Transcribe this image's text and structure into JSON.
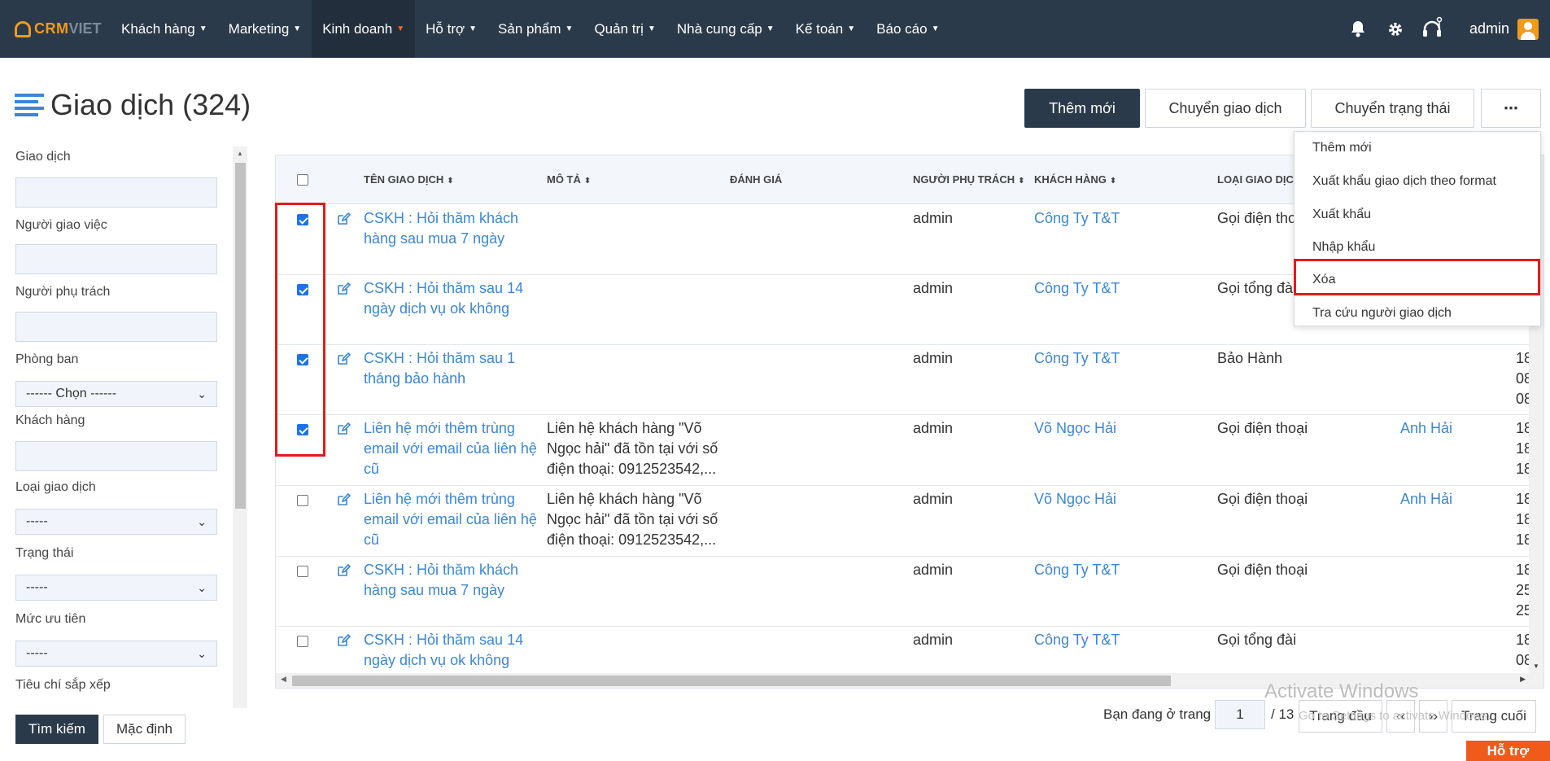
{
  "app": {
    "logo_primary": "CRM",
    "logo_secondary": "VIET",
    "user": "admin"
  },
  "nav": {
    "items": [
      {
        "label": "Khách hàng"
      },
      {
        "label": "Marketing"
      },
      {
        "label": "Kinh doanh"
      },
      {
        "label": "Hỗ trợ"
      },
      {
        "label": "Sản phẩm"
      },
      {
        "label": "Quản trị"
      },
      {
        "label": "Nhà cung cấp"
      },
      {
        "label": "Kế toán"
      },
      {
        "label": "Báo cáo"
      }
    ],
    "active_index": 2,
    "icons": [
      "bell-icon",
      "gear-icon",
      "headset-icon"
    ]
  },
  "page": {
    "title": "Giao dịch (324)",
    "buttons": {
      "add": "Thêm mới",
      "transfer": "Chuyển giao dịch",
      "change_status": "Chuyển trạng thái",
      "more": "⋯"
    }
  },
  "filters": {
    "transaction": "Giao dịch",
    "assigner": "Người giao việc",
    "owner": "Người phụ trách",
    "department": "Phòng ban",
    "department_value": "------ Chọn ------",
    "customer": "Khách hàng",
    "type": "Loại giao dịch",
    "type_value": "-----",
    "status": "Trạng thái",
    "status_value": "-----",
    "priority": "Mức ưu tiên",
    "priority_value": "-----",
    "sort": "Tiêu chí sắp xếp",
    "search_button": "Tìm kiếm",
    "default_button": "Mặc định"
  },
  "table": {
    "headers": {
      "name": "TÊN GIAO DỊCH",
      "desc": "MÔ TẢ",
      "rating": "ĐÁNH GIÁ",
      "owner": "NGƯỜI PHỤ TRÁCH",
      "customer": "KHÁCH HÀNG",
      "type": "LOẠI GIAO DỊCH"
    },
    "rows": [
      {
        "checked": true,
        "name": [
          "CSKH : Hỏi thăm khách",
          "hàng sau mua 7 ngày"
        ],
        "desc": [
          "",
          "",
          ""
        ],
        "owner": "admin",
        "customer": "Công Ty T&T",
        "type": "Gọi điện thoại",
        "contact": "",
        "date": [
          "",
          "",
          ""
        ]
      },
      {
        "checked": true,
        "name": [
          "CSKH : Hỏi thăm sau 14",
          "ngày dịch vụ ok không"
        ],
        "desc": [
          "",
          "",
          ""
        ],
        "owner": "admin",
        "customer": "Công Ty T&T",
        "type": "Gọi tổng đài",
        "contact": "",
        "date": [
          "",
          "",
          "08"
        ]
      },
      {
        "checked": true,
        "name": [
          "CSKH : Hỏi thăm sau 1",
          "tháng bảo hành"
        ],
        "desc": [
          "",
          "",
          ""
        ],
        "owner": "admin",
        "customer": "Công Ty T&T",
        "type": "Bảo Hành",
        "contact": "",
        "date": [
          "18",
          "08",
          "08"
        ]
      },
      {
        "checked": true,
        "name": [
          "Liên hệ mới thêm trùng",
          "email với email của liên hệ",
          "cũ"
        ],
        "desc": [
          "Liên hệ khách hàng \"Võ",
          "Ngọc hải\" đã tồn tại với số",
          "điện thoại: 0912523542,..."
        ],
        "owner": "admin",
        "customer": "Võ Ngọc Hải",
        "type": "Gọi điện thoại",
        "contact": "Anh Hải",
        "date": [
          "18",
          "18",
          "18"
        ]
      },
      {
        "checked": false,
        "name": [
          "Liên hệ mới thêm trùng",
          "email với email của liên hệ",
          "cũ"
        ],
        "desc": [
          "Liên hệ khách hàng \"Võ",
          "Ngọc hải\" đã tồn tại với số",
          "điện thoại: 0912523542,..."
        ],
        "owner": "admin",
        "customer": "Võ Ngọc Hải",
        "type": "Gọi điện thoại",
        "contact": "Anh Hải",
        "date": [
          "18",
          "18",
          "18"
        ]
      },
      {
        "checked": false,
        "name": [
          "CSKH : Hỏi thăm khách",
          "hàng sau mua 7 ngày"
        ],
        "desc": [
          "",
          "",
          ""
        ],
        "owner": "admin",
        "customer": "Công Ty T&T",
        "type": "Gọi điện thoại",
        "contact": "",
        "date": [
          "18",
          "25",
          "25"
        ]
      },
      {
        "checked": false,
        "name": [
          "CSKH : Hỏi thăm sau 14",
          "ngày dịch vụ ok không"
        ],
        "desc": [
          "",
          "",
          ""
        ],
        "owner": "admin",
        "customer": "Công Ty T&T",
        "type": "Gọi tổng đài",
        "contact": "",
        "date": [
          "18",
          "08",
          ""
        ]
      }
    ]
  },
  "dropdown": {
    "items": [
      "Thêm mới",
      "Xuất khẩu giao dịch theo format",
      "Xuất khẩu",
      "Nhập khẩu",
      "Xóa",
      "Tra cứu người giao dịch"
    ]
  },
  "pager": {
    "label": "Bạn đang ở trang",
    "current": "1",
    "total": "/ 13",
    "first": "Trang đầu",
    "prev": "‹‹",
    "next": "››",
    "last": "Trang cuối"
  },
  "watermark": {
    "line1": "Activate Windows",
    "line2": "Go to Settings to activate Windows."
  },
  "support": "Hỗ trợ"
}
